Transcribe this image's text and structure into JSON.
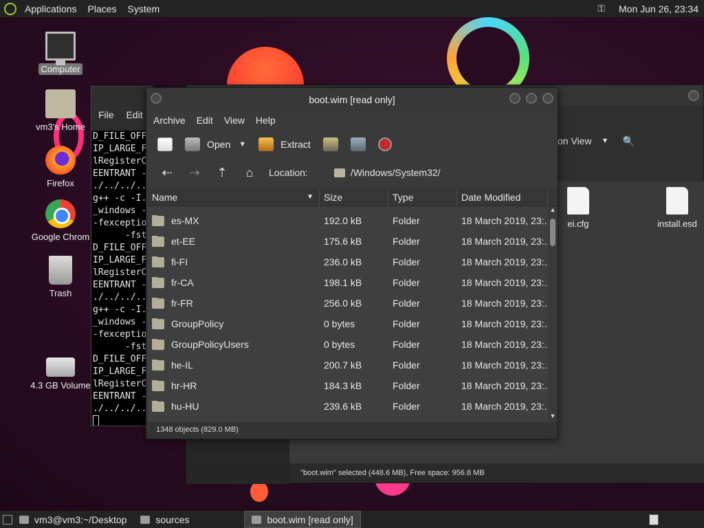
{
  "top_panel": {
    "menus": [
      "Applications",
      "Places",
      "System"
    ],
    "clock": "Mon Jun 26, 23:34"
  },
  "desktop_icons": [
    {
      "label": "Computer",
      "icon": "computer-icon"
    },
    {
      "label": "vm3's Home",
      "icon": "home-folder-icon"
    },
    {
      "label": "Firefox",
      "icon": "firefox-icon"
    },
    {
      "label": "Google Chrom",
      "icon": "chrome-icon"
    },
    {
      "label": "Trash",
      "icon": "trash-icon"
    },
    {
      "label": "4.3 GB Volume",
      "icon": "drive-icon"
    }
  ],
  "terminal": {
    "menu": [
      "File",
      "Edit"
    ],
    "lines": [
      "D_FILE_OFF",
      "IP_LARGE_F",
      "lRegisterC",
      "EENTRANT -",
      "./../../..",
      "g++ -c -I.",
      "_windows -",
      "-fexceptio",
      "      -fst",
      "D_FILE_OFF",
      "IP_LARGE_F",
      "lRegisterC",
      "EENTRANT -",
      "./../../..",
      "g++ -c -I.",
      "_windows -",
      "-fexceptio",
      "      -fst",
      "D_FILE_OFF",
      "IP_LARGE_F",
      "lRegisterC",
      "EENTRANT -",
      "./../../.."
    ]
  },
  "file_manager": {
    "view_label": "on View",
    "files": [
      "ei.cfg",
      "install.esd"
    ],
    "status": "\"boot.wim\" selected (448.6 MB), Free space: 956.8 MB"
  },
  "archive": {
    "title": "boot.wim [read only]",
    "menu": [
      "Archive",
      "Edit",
      "View",
      "Help"
    ],
    "toolbar": {
      "open": "Open",
      "extract": "Extract"
    },
    "location_label": "Location:",
    "location_path": "/Windows/System32/",
    "columns": [
      "Name",
      "Size",
      "Type",
      "Date Modified"
    ],
    "rows": [
      {
        "name": "es-MX",
        "size": "192.0 kB",
        "type": "Folder",
        "date": "18 March 2019, 23:..."
      },
      {
        "name": "et-EE",
        "size": "175.6 kB",
        "type": "Folder",
        "date": "18 March 2019, 23:..."
      },
      {
        "name": "fi-FI",
        "size": "236.0 kB",
        "type": "Folder",
        "date": "18 March 2019, 23:..."
      },
      {
        "name": "fr-CA",
        "size": "198.1 kB",
        "type": "Folder",
        "date": "18 March 2019, 23:..."
      },
      {
        "name": "fr-FR",
        "size": "256.0 kB",
        "type": "Folder",
        "date": "18 March 2019, 23:..."
      },
      {
        "name": "GroupPolicy",
        "size": "0 bytes",
        "type": "Folder",
        "date": "18 March 2019, 23:..."
      },
      {
        "name": "GroupPolicyUsers",
        "size": "0 bytes",
        "type": "Folder",
        "date": "18 March 2019, 23:..."
      },
      {
        "name": "he-IL",
        "size": "200.7 kB",
        "type": "Folder",
        "date": "18 March 2019, 23:..."
      },
      {
        "name": "hr-HR",
        "size": "184.3 kB",
        "type": "Folder",
        "date": "18 March 2019, 23:..."
      },
      {
        "name": "hu-HU",
        "size": "239.6 kB",
        "type": "Folder",
        "date": "18 March 2019, 23:..."
      }
    ],
    "status": "1348 objects (829.0 MB)"
  },
  "taskbar": {
    "tasks": [
      "vm3@vm3:~/Desktop",
      "sources",
      "boot.wim [read only]"
    ]
  }
}
